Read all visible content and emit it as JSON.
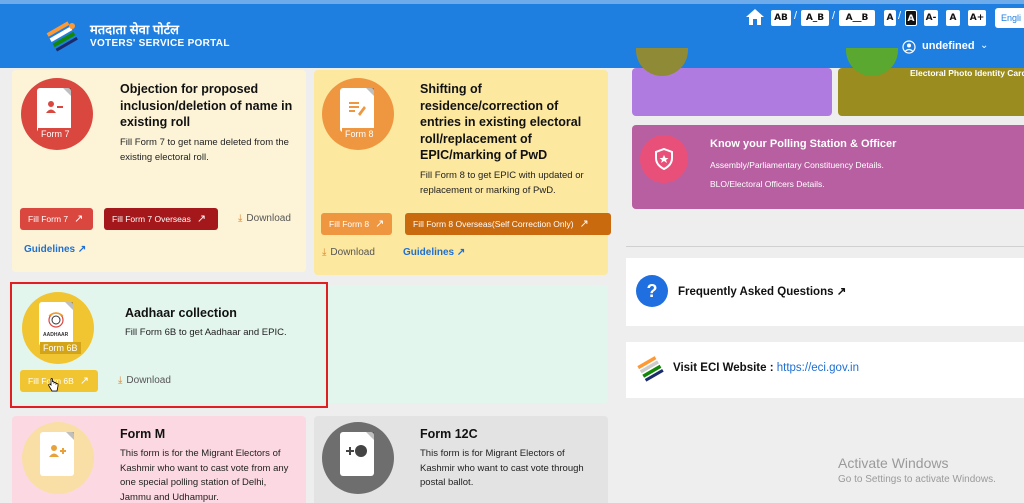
{
  "header": {
    "brand_hindi": "मतदाता सेवा पोर्टल",
    "brand_english": "VOTERS' SERVICE PORTAL",
    "accessibility": {
      "spacing": [
        "AB",
        "A_B",
        "A__B"
      ],
      "contrast": [
        "A",
        "A"
      ],
      "font_size": [
        "A-",
        "A",
        "A+"
      ]
    },
    "language": "Engli",
    "user_name": "undefined"
  },
  "cards": {
    "form7": {
      "tag": "Form 7",
      "title": "Objection for proposed inclusion/deletion of name in existing roll",
      "desc": "Fill Form 7 to get name deleted from the existing electoral roll.",
      "btn_fill": "Fill Form 7",
      "btn_overseas": "Fill Form 7 Overseas",
      "download": "Download",
      "guidelines": "Guidelines"
    },
    "form8": {
      "tag": "Form 8",
      "title": "Shifting of residence/correction of entries in existing electoral roll/replacement of EPIC/marking of PwD",
      "desc": "Fill Form 8 to get EPIC with updated or replacement or marking of PwD.",
      "btn_fill": "Fill Form 8",
      "btn_overseas": "Fill Form 8 Overseas(Self Correction Only)",
      "download": "Download",
      "guidelines": "Guidelines"
    },
    "form6b": {
      "tag": "Form 6B",
      "logo_text": "AADHAAR",
      "title": "Aadhaar collection",
      "desc": "Fill Form 6B to get Aadhaar and EPIC.",
      "btn_fill": "Fill Form 6B",
      "download": "Download"
    },
    "formm": {
      "title": "Form M",
      "desc": "This form is for the Migrant Electors of Kashmir who want to cast vote from any one special polling station of Delhi, Jammu and Udhampur."
    },
    "form12c": {
      "title": "Form 12C",
      "desc": "This form is for Migrant Electors of Kashmir who want to cast vote through postal ballot."
    }
  },
  "right": {
    "epic_caption": "Electoral Photo Identity Card",
    "polling": {
      "title": "Know your Polling Station & Officer",
      "line1": "Assembly/Parliamentary Constituency Details.",
      "line2": "BLO/Electoral Officers Details."
    },
    "faq": "Frequently Asked Questions",
    "eci_label": "Visit ECI Website : ",
    "eci_url": "https://eci.gov.in"
  },
  "watermark": {
    "line1": "Activate Windows",
    "line2": "Go to Settings to activate Windows."
  }
}
